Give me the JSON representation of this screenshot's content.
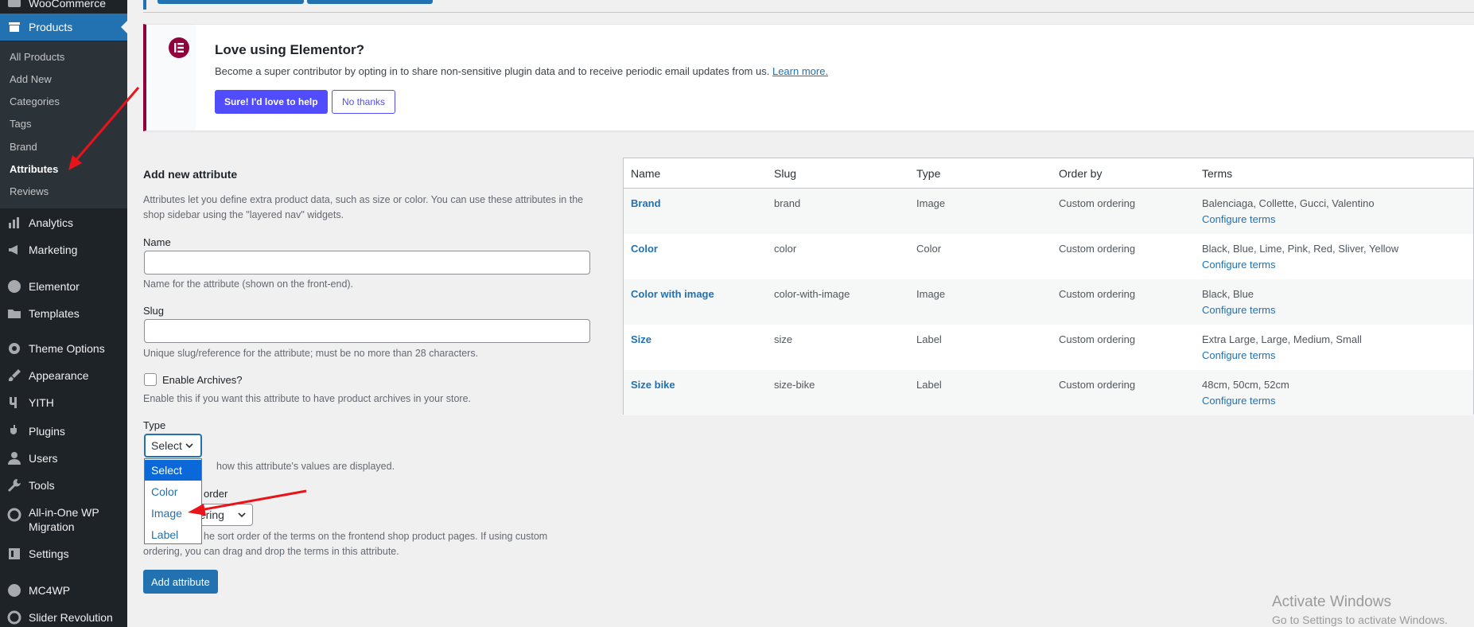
{
  "sidebar": {
    "items": [
      {
        "label": "WooCommerce",
        "icon": "woocommerce-icon"
      },
      {
        "label": "Products",
        "icon": "products-icon"
      },
      {
        "label": "Analytics",
        "icon": "analytics-icon"
      },
      {
        "label": "Marketing",
        "icon": "megaphone-icon"
      },
      {
        "label": "Elementor",
        "icon": "elementor-icon"
      },
      {
        "label": "Templates",
        "icon": "folder-icon"
      },
      {
        "label": "Theme Options",
        "icon": "gear-icon"
      },
      {
        "label": "Appearance",
        "icon": "brush-icon"
      },
      {
        "label": "YITH",
        "icon": "yith-icon"
      },
      {
        "label": "Plugins",
        "icon": "plug-icon"
      },
      {
        "label": "Users",
        "icon": "user-icon"
      },
      {
        "label": "Tools",
        "icon": "wrench-icon"
      },
      {
        "label": "All-in-One WP",
        "label2": "Migration",
        "icon": "migration-icon"
      },
      {
        "label": "Settings",
        "icon": "settings-icon"
      },
      {
        "label": "MC4WP",
        "icon": "mc4wp-icon"
      },
      {
        "label": "Slider Revolution",
        "icon": "slider-icon"
      }
    ],
    "submenu": [
      "All Products",
      "Add New",
      "Categories",
      "Tags",
      "Brand",
      "Attributes",
      "Reviews"
    ]
  },
  "notice": {
    "title": "Love using Elementor?",
    "text": "Become a super contributor by opting in to share non-sensitive plugin data and to receive periodic email updates from us.",
    "link": "Learn more.",
    "yes_button": "Sure! I'd love to help",
    "no_button": "No thanks"
  },
  "form": {
    "heading": "Add new attribute",
    "intro_line1": "Attributes let you define extra product data, such as size or color. You can use these attributes in the",
    "intro_line2": "shop sidebar using the \"layered nav\" widgets.",
    "name_label": "Name",
    "name_help": "Name for the attribute (shown on the front-end).",
    "slug_label": "Slug",
    "slug_help": "Unique slug/reference for the attribute; must be no more than 28 characters.",
    "archives_label": "Enable Archives?",
    "archives_help": "Enable this if you want this attribute to have product archives in your store.",
    "type_label": "Type",
    "type_value": "Select",
    "type_help": "how this attribute's values are displayed.",
    "type_options": [
      "Select",
      "Color",
      "Image",
      "Label"
    ],
    "order_label": "order",
    "order_value": "dering",
    "order_help1": "he sort order of the terms on the frontend shop product pages. If using custom",
    "order_help2": "ordering, you can drag and drop the terms in this attribute.",
    "submit": "Add attribute"
  },
  "table": {
    "headers": [
      "Name",
      "Slug",
      "Type",
      "Order by",
      "Terms"
    ],
    "configure_label": "Configure terms",
    "rows": [
      {
        "name": "Brand",
        "slug": "brand",
        "type": "Image",
        "order": "Custom ordering",
        "terms": "Balenciaga, Collette, Gucci, Valentino"
      },
      {
        "name": "Color",
        "slug": "color",
        "type": "Color",
        "order": "Custom ordering",
        "terms": "Black, Blue, Lime, Pink, Red, Sliver, Yellow"
      },
      {
        "name": "Color with image",
        "slug": "color-with-image",
        "type": "Image",
        "order": "Custom ordering",
        "terms": "Black, Blue"
      },
      {
        "name": "Size",
        "slug": "size",
        "type": "Label",
        "order": "Custom ordering",
        "terms": "Extra Large, Large, Medium, Small"
      },
      {
        "name": "Size bike",
        "slug": "size-bike",
        "type": "Label",
        "order": "Custom ordering",
        "terms": "48cm, 50cm, 52cm"
      }
    ]
  },
  "watermark": {
    "line1": "Activate Windows",
    "line2": "Go to Settings to activate Windows."
  },
  "colors": {
    "accent": "#2271b1",
    "sidebar_bg": "#1d2327",
    "elementor": "#92003b",
    "elementor_button": "#524cff",
    "annotation_arrow": "#e8141a"
  }
}
